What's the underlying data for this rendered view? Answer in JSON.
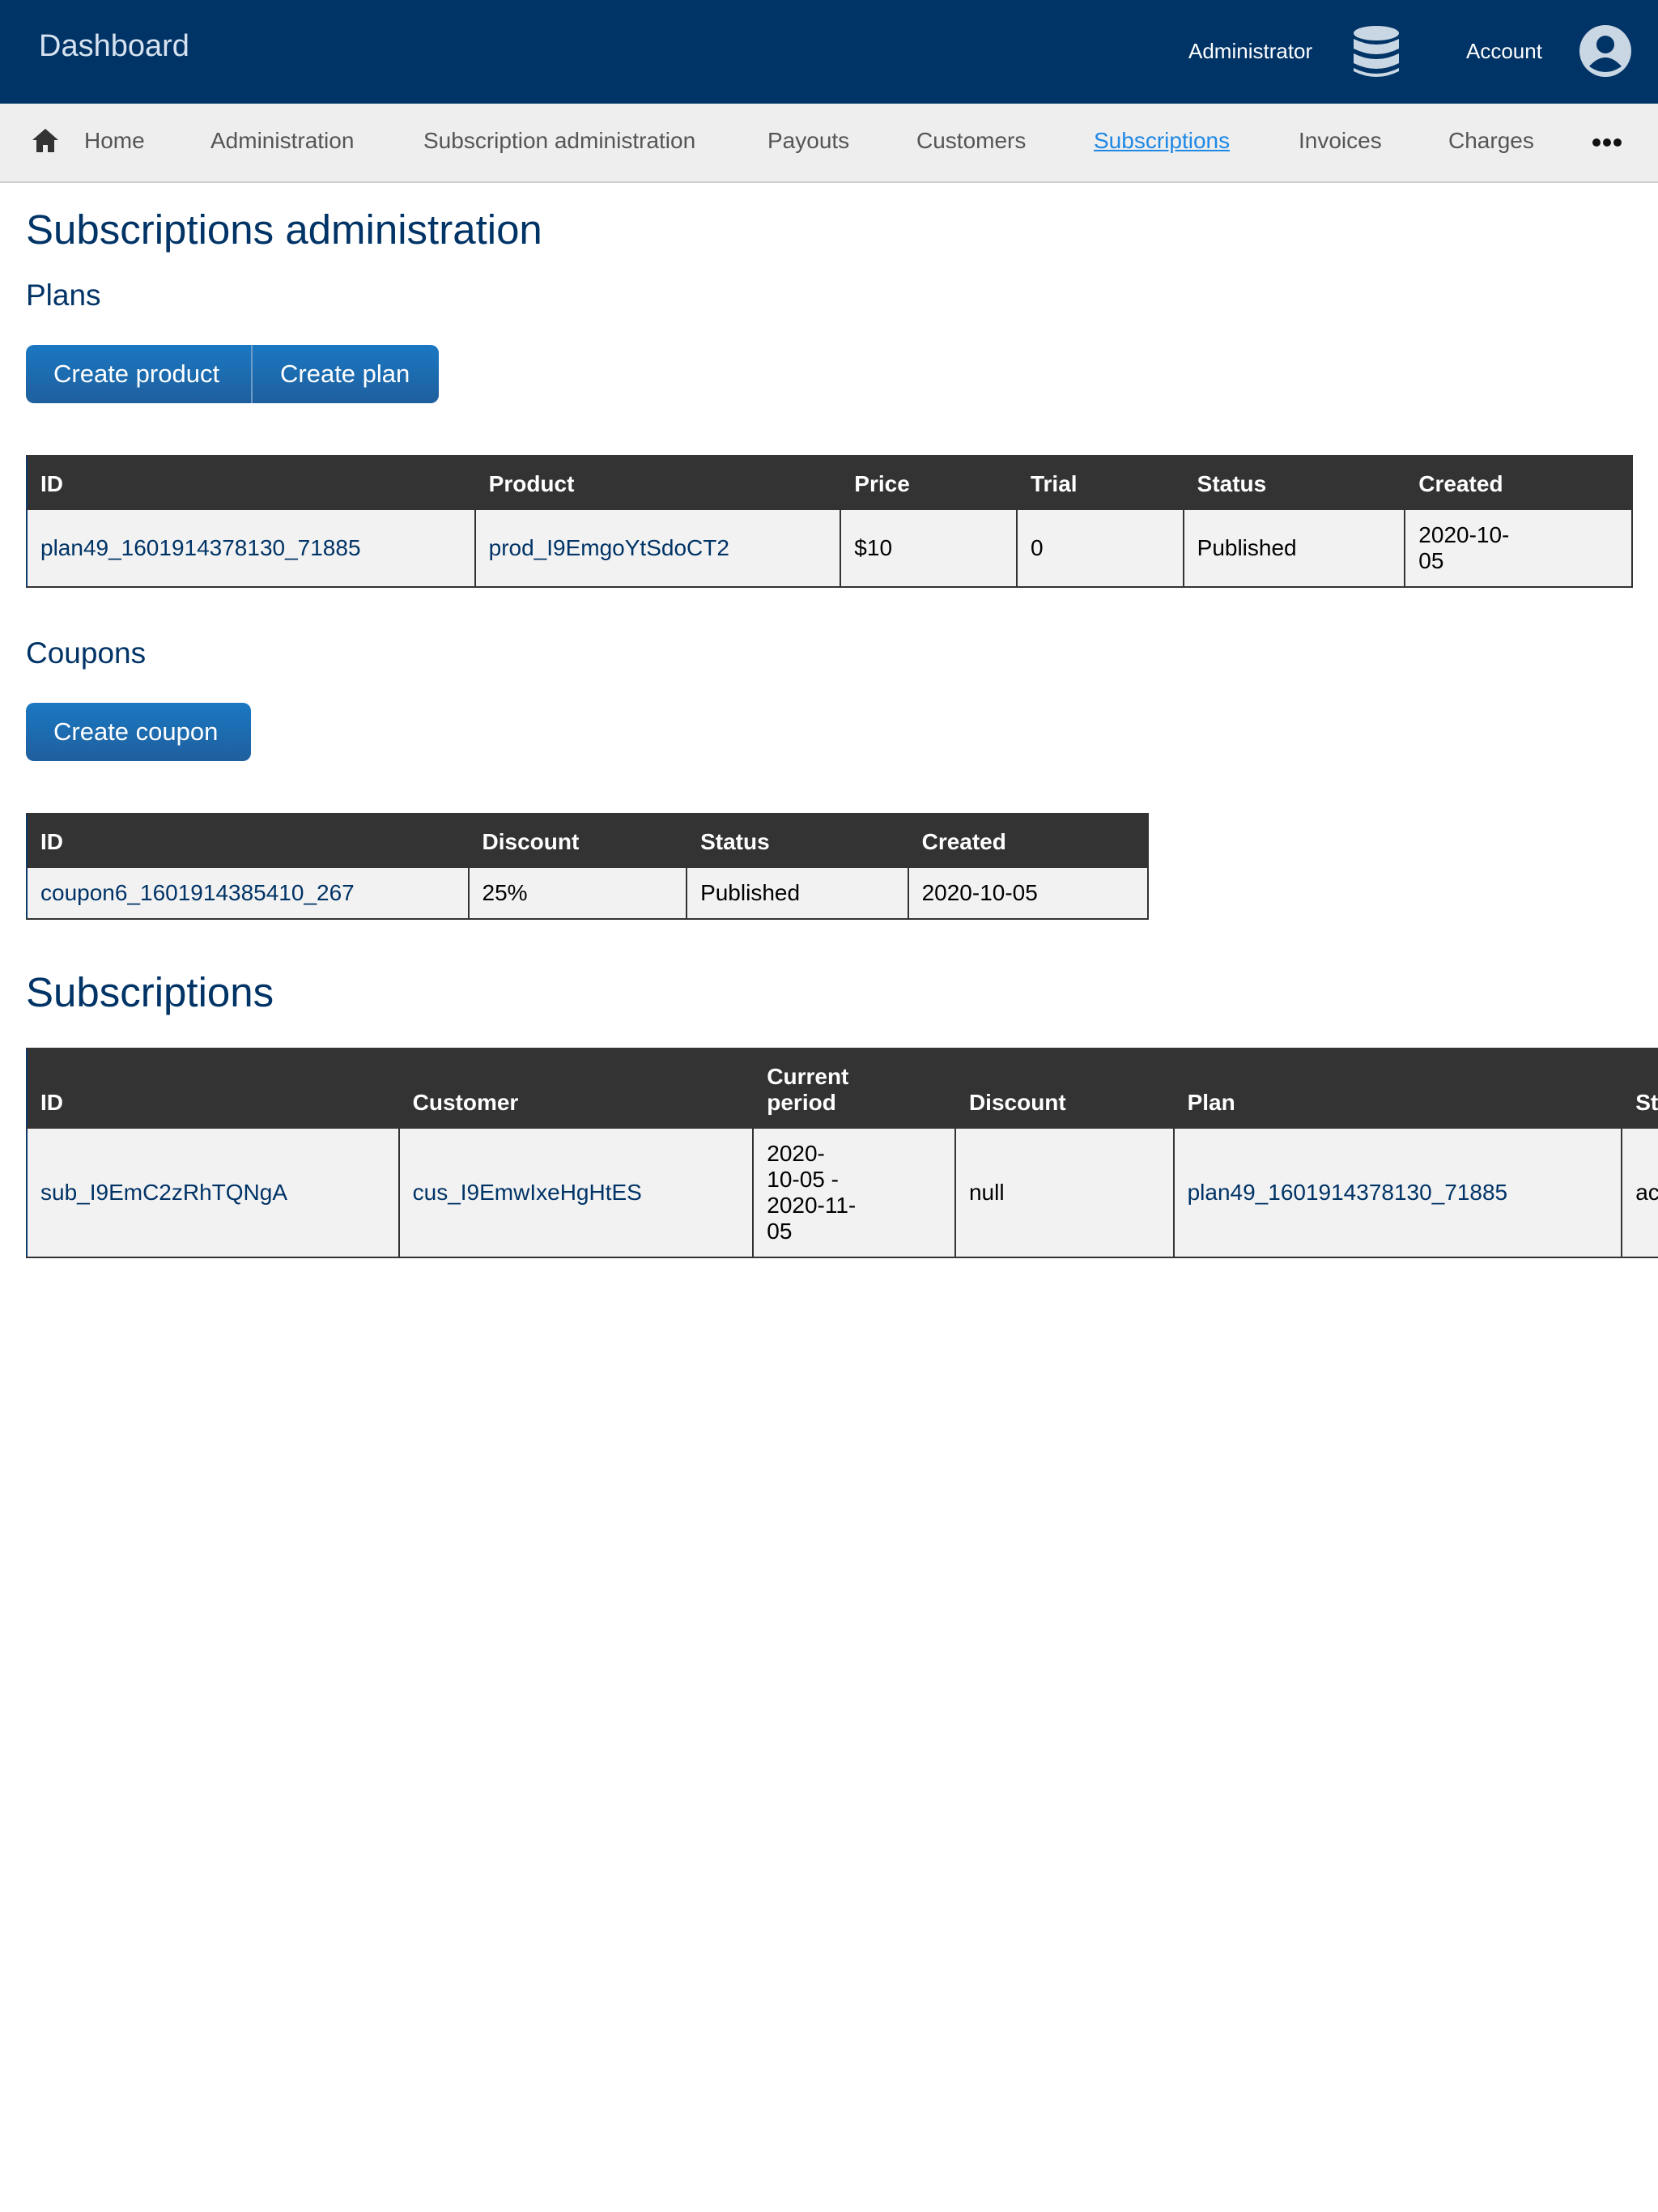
{
  "header": {
    "brand": "Dashboard",
    "administrator_link": "Administrator",
    "account_link": "Account",
    "icons": {
      "database": "database-icon",
      "user": "user-circle-icon"
    },
    "background_color": "#003366"
  },
  "nav": {
    "items": [
      {
        "label": "Home",
        "active": false
      },
      {
        "label": "Administration",
        "active": false
      },
      {
        "label": "Subscription administration",
        "active": false
      },
      {
        "label": "Payouts",
        "active": false
      },
      {
        "label": "Customers",
        "active": false
      },
      {
        "label": "Subscriptions",
        "active": true
      },
      {
        "label": "Invoices",
        "active": false
      },
      {
        "label": "Charges",
        "active": false
      }
    ],
    "icons": {
      "home": "home-icon",
      "more": "more-icon"
    }
  },
  "page": {
    "title": "Subscriptions administration"
  },
  "plans": {
    "heading": "Plans",
    "buttons": {
      "create_product": "Create product",
      "create_plan": "Create plan"
    },
    "columns": [
      "ID",
      "Product",
      "Price",
      "Trial",
      "Status",
      "Created"
    ],
    "rows": [
      {
        "id": "plan49_1601914378130_71885",
        "product": "prod_I9EmgoYtSdoCT2",
        "price": "$10",
        "trial": "0",
        "status": "Published",
        "created": "2020-10-05"
      }
    ]
  },
  "coupons": {
    "heading": "Coupons",
    "buttons": {
      "create_coupon": "Create coupon"
    },
    "columns": [
      "ID",
      "Discount",
      "Status",
      "Created"
    ],
    "rows": [
      {
        "id": "coupon6_1601914385410_267",
        "discount": "25%",
        "status": "Published",
        "created": "2020-10-05"
      }
    ]
  },
  "subscriptions": {
    "heading": "Subscriptions",
    "columns": [
      "ID",
      "Customer",
      "Current period",
      "Discount",
      "Plan",
      "St"
    ],
    "rows": [
      {
        "id": "sub_I9EmC2zRhTQNgA",
        "customer": "cus_I9EmwIxeHgHtES",
        "current_period": "2020-10-05 - 2020-11-05",
        "discount": "null",
        "plan": "plan49_1601914378130_71885",
        "status": "ac"
      }
    ]
  },
  "colors": {
    "heading": "#003366",
    "active_nav": "#1e88e5",
    "button": "#1a78c2",
    "table_header": "#333333",
    "table_cell": "#f2f2f2"
  }
}
